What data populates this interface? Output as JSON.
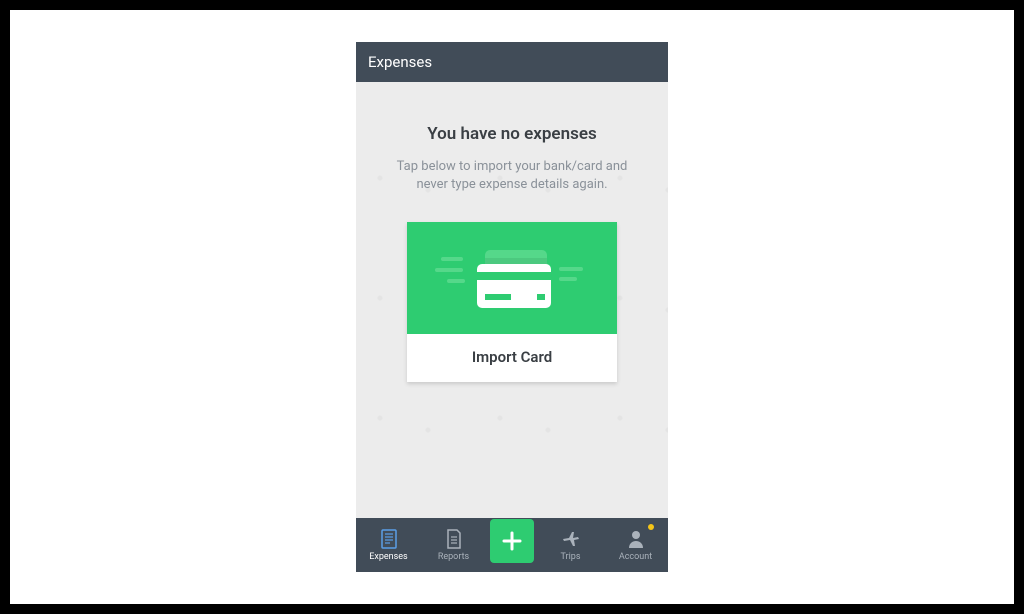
{
  "header": {
    "title": "Expenses"
  },
  "empty": {
    "title": "You have no expenses",
    "subtitle": "Tap below to import your bank/card and never type expense details again."
  },
  "importCard": {
    "label": "Import Card"
  },
  "tabs": {
    "expenses": "Expenses",
    "reports": "Reports",
    "trips": "Trips",
    "account": "Account"
  }
}
